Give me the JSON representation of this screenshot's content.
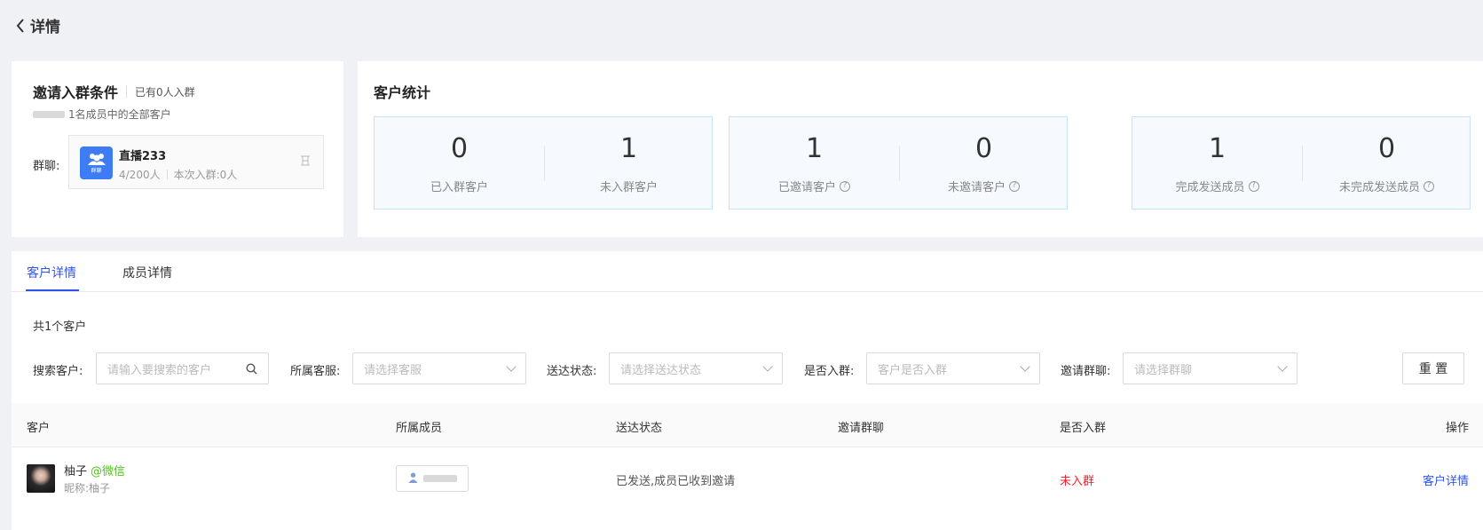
{
  "header": {
    "title": "详情"
  },
  "condition": {
    "title": "邀请入群条件",
    "joined_note": "已有0人入群",
    "scope": "1名成员中的全部客户",
    "group_label": "群聊:",
    "group": {
      "avatar_text": "群聊",
      "name": "直播233",
      "capacity": "4/200人",
      "this_time": "本次入群:0人"
    }
  },
  "stats": {
    "title": "客户统计",
    "boxes": [
      [
        {
          "value": "0",
          "label": "已入群客户",
          "help": false
        },
        {
          "value": "1",
          "label": "未入群客户",
          "help": false
        }
      ],
      [
        {
          "value": "1",
          "label": "已邀请客户",
          "help": true
        },
        {
          "value": "0",
          "label": "未邀请客户",
          "help": true
        }
      ],
      [
        {
          "value": "1",
          "label": "完成发送成员",
          "help": true
        },
        {
          "value": "0",
          "label": "未完成发送成员",
          "help": true
        }
      ]
    ]
  },
  "tabs": [
    "客户详情",
    "成员详情"
  ],
  "total_text": "共1个客户",
  "filters": {
    "customer_label": "搜索客户:",
    "customer_placeholder": "请输入要搜索的客户",
    "service_label": "所属客服:",
    "service_placeholder": "请选择客服",
    "delivery_label": "送达状态:",
    "delivery_placeholder": "请选择送达状态",
    "joined_label": "是否入群:",
    "joined_placeholder": "客户是否入群",
    "invite_label": "邀请群聊:",
    "invite_placeholder": "请选择群聊",
    "reset_label": "重 置"
  },
  "table": {
    "headers": [
      "客户",
      "所属成员",
      "送达状态",
      "邀请群聊",
      "是否入群",
      "操作"
    ],
    "rows": [
      {
        "name": "柚子",
        "source": "@微信",
        "nickname": "昵称:柚子",
        "delivery": "已发送,成员已收到邀请",
        "invite_group": "",
        "joined": "未入群",
        "action": "客户详情"
      }
    ]
  },
  "colors": {
    "accent": "#2f54eb",
    "wechat": "#52c41a",
    "danger": "#f5222d",
    "group_avatar": "#3d7cf5"
  }
}
